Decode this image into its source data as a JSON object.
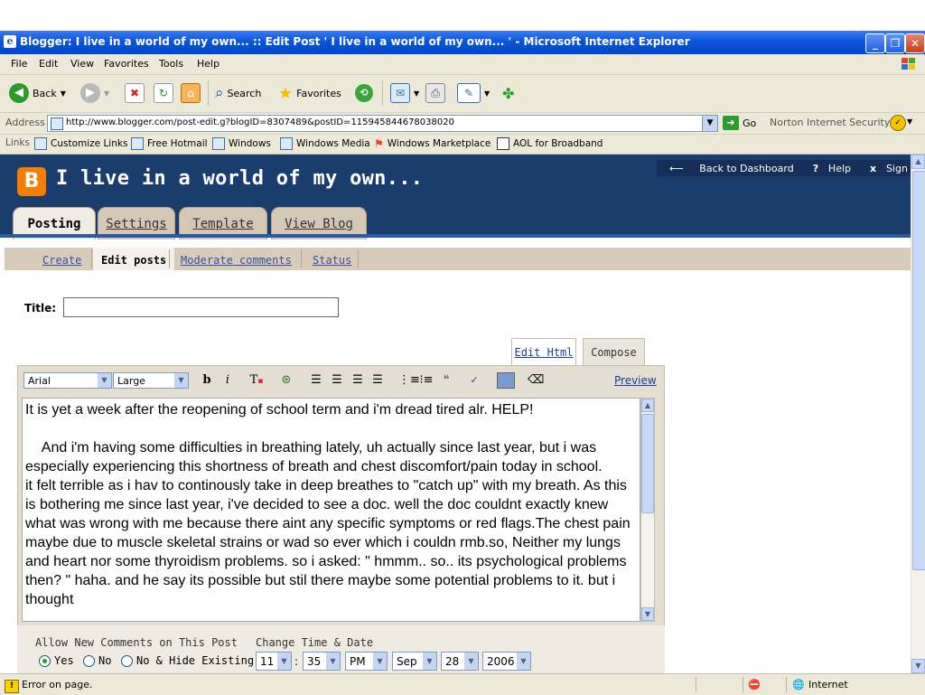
{
  "window": {
    "title": "Blogger: I live in a world of my own... :: Edit Post ' I live in a world of my own... ' - Microsoft Internet Explorer"
  },
  "menu": [
    "File",
    "Edit",
    "View",
    "Favorites",
    "Tools",
    "Help"
  ],
  "toolbar": {
    "back": "Back",
    "search": "Search",
    "favorites": "Favorites"
  },
  "address": {
    "label": "Address",
    "url": "http://www.blogger.com/post-edit.g?blogID=8307489&postID=115945844678038020",
    "go": "Go",
    "norton": "Norton Internet Security"
  },
  "links": {
    "label": "Links",
    "items": [
      "Customize Links",
      "Free Hotmail",
      "Windows",
      "Windows Media",
      "Windows Marketplace",
      "AOL for Broadband"
    ]
  },
  "blogger": {
    "logo_letter": "B",
    "blog_title": "I live in a world of my own...",
    "back_to_dashboard": "Back to Dashboard",
    "help": "Help",
    "sign_out": "Sign Out",
    "tabs": [
      "Posting",
      "Settings",
      "Template",
      "View Blog"
    ],
    "subnav": [
      "Create",
      "Edit posts",
      "Moderate comments",
      "Status"
    ]
  },
  "post": {
    "title_label": "Title:",
    "title_value": "",
    "edit_html_tab": "Edit Html",
    "compose_tab": "Compose",
    "font_select": "Arial",
    "size_select": "Large",
    "preview": "Preview",
    "body": "It is yet a week after the reopening of school term and i'm dread tired alr. HELP!\n\n    And i'm having some difficulties in breathing lately, uh actually since last year, but i was especially experiencing this shortness of breath and chest discomfort/pain today in school.\nit felt terrible as i hav to continously take in deep breathes to \"catch up\" with my breath. As this is bothering me since last year, i've decided to see a doc. well the doc couldnt exactly knew what was wrong with me because there aint any specific symptoms or red flags.The chest pain maybe due to muscle skeletal strains or wad so ever which i couldn rmb.so, Neither my lungs and heart nor some thyroidism problems. so i asked: \" hmmm.. so.. its psychological problems then? \" haha. and he say its possible but stil there maybe some potential problems to it. but i thought"
  },
  "options": {
    "allow_comments_label": "Allow New Comments on This Post",
    "radio_yes": "Yes",
    "radio_no": "No",
    "radio_hide": "No & Hide Existing",
    "selected_radio": "Yes",
    "change_time_label": "Change Time & Date",
    "hour": "11",
    "minute": "35",
    "ampm": "PM",
    "month": "Sep",
    "day": "28",
    "year": "2006"
  },
  "status": {
    "text": "Error on page.",
    "zone": "Internet"
  },
  "colors": {
    "blogger_header": "#1b3d6e",
    "blogger_orange": "#f57d00",
    "tab_tan": "#d5c7b6",
    "xp_blue": "#0a55dd"
  }
}
